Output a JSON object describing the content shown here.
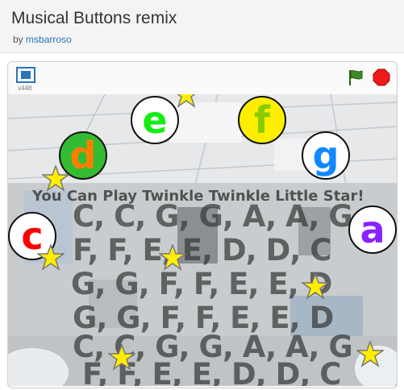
{
  "project": {
    "title": "Musical Buttons remix",
    "by_label": "by",
    "author": "msbarroso"
  },
  "player": {
    "version": "v448",
    "icons": [
      "fullscreen-icon",
      "green-flag-icon",
      "stop-icon"
    ]
  },
  "stage": {
    "heading": "You Can Play Twinkle Twinkle Little Star!",
    "lyrics": [
      "C, C, G, G, A, A, G",
      "F, F, E, E, D, D, C",
      "G, G, F, F, E, E, D",
      "G, G, F, F, E, E, D",
      "C, C, G, G, A, A, G",
      "F, F, E, E, D, D, C"
    ],
    "notes": [
      {
        "letter": "c",
        "text_color": "#ff0000",
        "fill": "#ffffff"
      },
      {
        "letter": "d",
        "text_color": "#ff7f00",
        "fill": "#33bb33"
      },
      {
        "letter": "e",
        "text_color": "#11ee11",
        "fill": "#ffffff"
      },
      {
        "letter": "f",
        "text_color": "#88cc00",
        "fill": "#ffee00"
      },
      {
        "letter": "g",
        "text_color": "#1188ff",
        "fill": "#ffffff"
      },
      {
        "letter": "a",
        "text_color": "#8822ff",
        "fill": "#ffffff"
      }
    ],
    "star_icon": "star-icon"
  }
}
